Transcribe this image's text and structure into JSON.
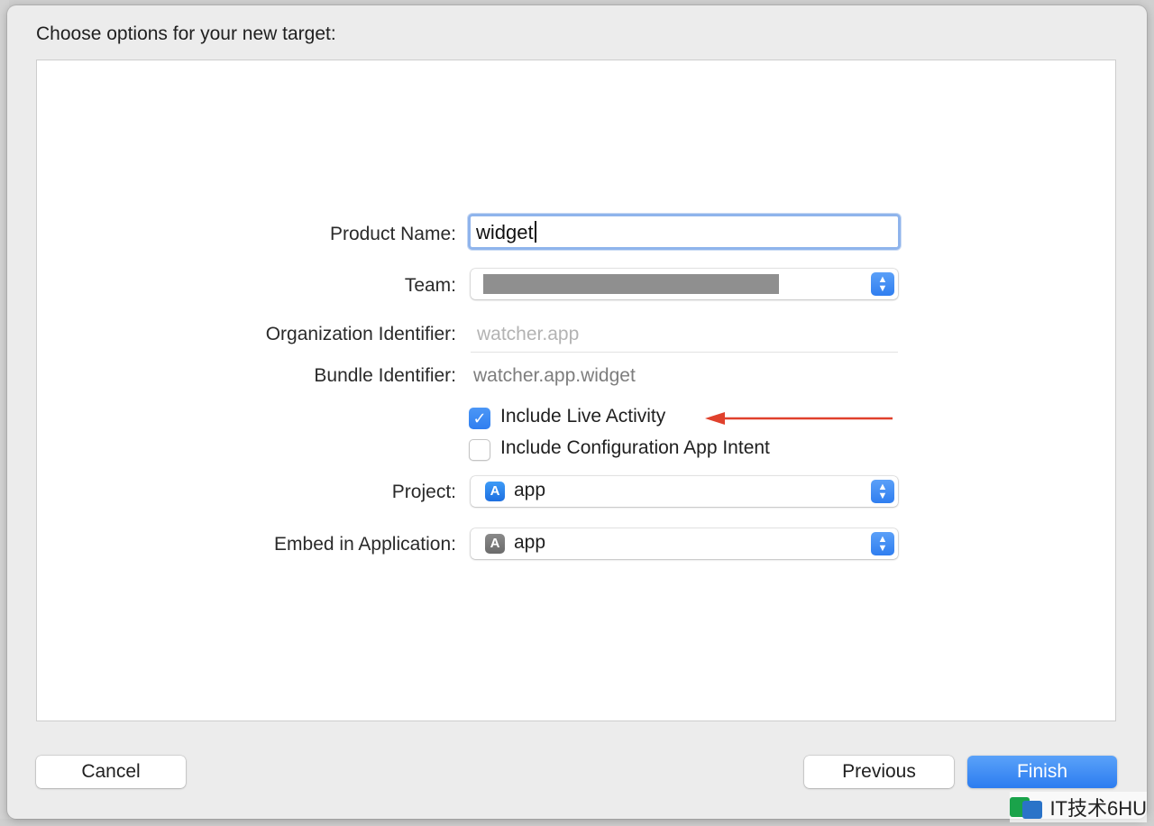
{
  "dialog": {
    "title": "Choose options for your new target:"
  },
  "form": {
    "product_name": {
      "label": "Product Name:",
      "value": "widget"
    },
    "team": {
      "label": "Team:"
    },
    "organization_identifier": {
      "label": "Organization Identifier:",
      "value": "watcher.app"
    },
    "bundle_identifier": {
      "label": "Bundle Identifier:",
      "value": "watcher.app.widget"
    },
    "include_live_activity": {
      "label": "Include Live Activity",
      "checked": true
    },
    "include_configuration_intent": {
      "label": "Include Configuration App Intent",
      "checked": false
    },
    "project": {
      "label": "Project:",
      "value": "app",
      "icon": "app-store-icon"
    },
    "embed_in_application": {
      "label": "Embed in Application:",
      "value": "app",
      "icon": "app-store-icon"
    }
  },
  "annotation": {
    "arrow_color": "#e0412c"
  },
  "buttons": {
    "cancel": "Cancel",
    "previous": "Previous",
    "finish": "Finish"
  },
  "colors": {
    "accent": "#2f7ef0"
  },
  "watermark": {
    "text": "IT技术6HU"
  }
}
